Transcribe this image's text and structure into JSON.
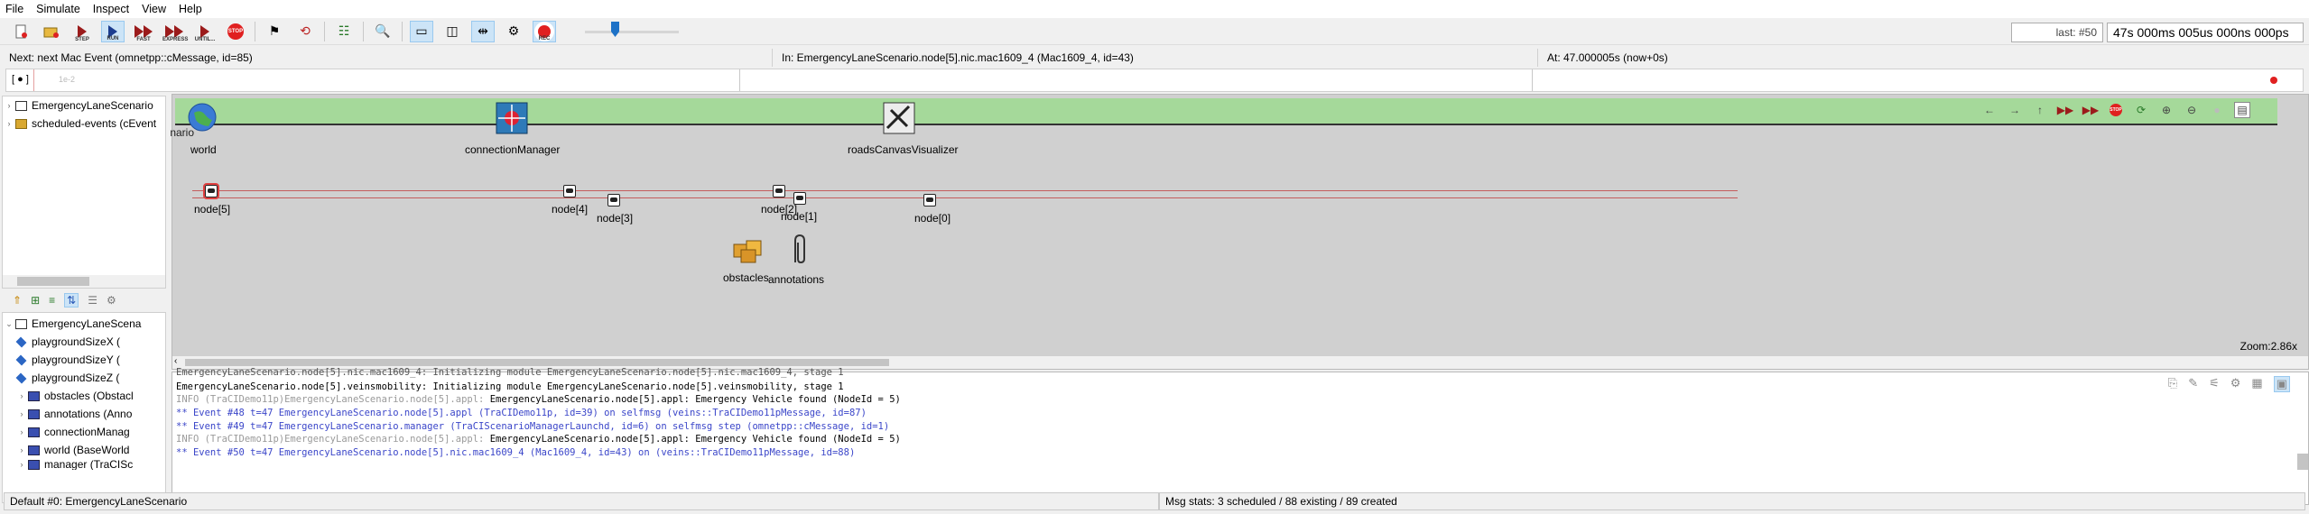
{
  "menu": [
    "File",
    "Simulate",
    "Inspect",
    "View",
    "Help"
  ],
  "toolbar": {
    "step_label": "STEP",
    "run_label": "RUN",
    "fast_label": "FAST",
    "express_label": "EXPRESS",
    "until_label": "UNTIL...",
    "stop_label": "STOP",
    "rec_label": "REC",
    "last_event": "last: #50",
    "sim_time": "47s 000ms 005us 000ns 000ps"
  },
  "status": {
    "next": "Next: next Mac Event (omnetpp::cMessage, id=85)",
    "in": "In: EmergencyLaneScenario.node[5].nic.mac1609_4 (Mac1609_4, id=43)",
    "at": "At: 47.000005s (now+0s)"
  },
  "timeline": {
    "marker": "[ ● ]",
    "hint": "1e-2"
  },
  "object_tree": [
    {
      "label": "EmergencyLaneScenario",
      "icon": "network-icon"
    },
    {
      "label": "scheduled-events (cEvent",
      "icon": "events-icon"
    }
  ],
  "inspector_tree": [
    {
      "label": "EmergencyLaneScena",
      "icon": "network-icon",
      "expanded": true
    },
    {
      "label": "playgroundSizeX (",
      "icon": "param-icon"
    },
    {
      "label": "playgroundSizeY (",
      "icon": "param-icon"
    },
    {
      "label": "playgroundSizeZ (",
      "icon": "param-icon"
    },
    {
      "label": "obstacles (Obstacl",
      "icon": "module-icon"
    },
    {
      "label": "annotations (Anno",
      "icon": "module-icon"
    },
    {
      "label": "connectionManag",
      "icon": "module-icon"
    },
    {
      "label": "world (BaseWorld",
      "icon": "module-icon"
    },
    {
      "label": "manager (TraCISc",
      "icon": "module-icon"
    }
  ],
  "canvas": {
    "network_label": "EmergencyLaneScenario",
    "modules": {
      "world": "world",
      "connection_manager": "connectionManager",
      "roads": "roadsCanvasVisualizer",
      "obstacles": "obstacles",
      "annotations": "annotations"
    },
    "nodes": [
      "node[5]",
      "node[4]",
      "node[3]",
      "node[2]",
      "node[1]",
      "node[0]"
    ],
    "zoom": "Zoom:2.86x"
  },
  "log": [
    {
      "text": "EmergencyLaneScenario.node[5].nic.mac1609_4: Initializing module EmergencyLaneScenario.node[5].nic.mac1609_4, stage 1",
      "kind": "plain"
    },
    {
      "text": "EmergencyLaneScenario.node[5].veinsmobility: Initializing module EmergencyLaneScenario.node[5].veinsmobility, stage 1",
      "kind": "plain"
    },
    {
      "text": "INFO (TraCIDemo11p)EmergencyLaneScenario.node[5].appl: EmergencyLaneScenario.node[5].appl: Emergency Vehicle found (NodeId = 5)",
      "kind": "info"
    },
    {
      "text": "** Event #48  t=47  EmergencyLaneScenario.node[5].appl (TraCIDemo11p, id=39)  on selfmsg  (veins::TraCIDemo11pMessage, id=87)",
      "kind": "event"
    },
    {
      "text": "** Event #49  t=47  EmergencyLaneScenario.manager (TraCIScenarioManagerLaunchd, id=6)  on selfmsg step (omnetpp::cMessage, id=1)",
      "kind": "event"
    },
    {
      "text": "INFO (TraCIDemo11p)EmergencyLaneScenario.node[5].appl: EmergencyLaneScenario.node[5].appl: Emergency Vehicle found (NodeId = 5)",
      "kind": "info"
    },
    {
      "text": "** Event #50  t=47  EmergencyLaneScenario.node[5].nic.mac1609_4 (Mac1609_4, id=43)  on  (veins::TraCIDemo11pMessage, id=88)",
      "kind": "event"
    }
  ],
  "bottom": {
    "default_label": "Default #0: EmergencyLaneScenario",
    "msg_stats": "Msg stats: 3 scheduled / 88 existing / 89 created"
  },
  "colors": {
    "canvas_bg": "#d0d0d0",
    "green_band": "#a5d99a",
    "road": "#c45c5c",
    "event_blue": "#3b46c9",
    "info_grey": "#9a9a9a"
  }
}
